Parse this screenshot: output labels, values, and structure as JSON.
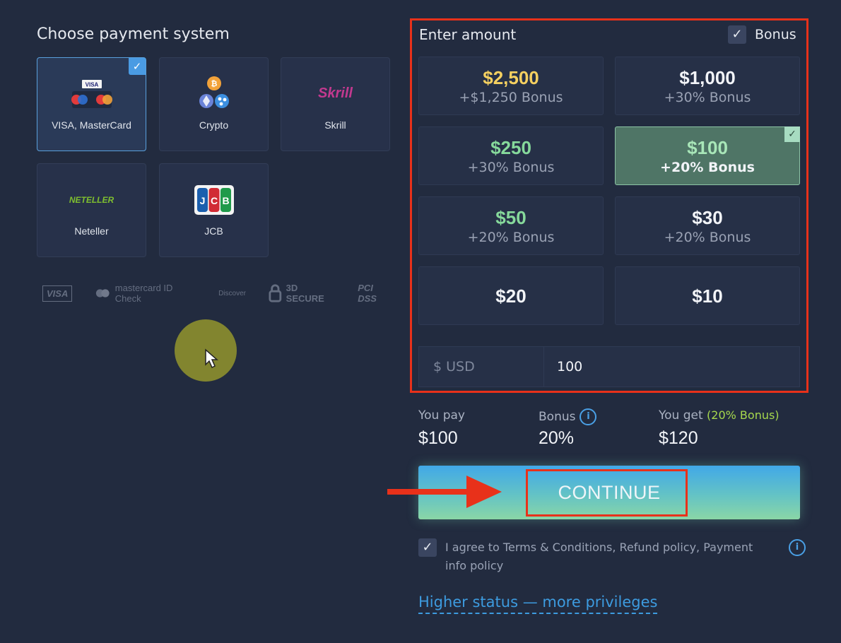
{
  "left": {
    "title": "Choose payment system",
    "methods": [
      {
        "label": "VISA, MasterCard",
        "icon": "visa-mastercard-icon",
        "selected": true,
        "logo_text": "VISA"
      },
      {
        "label": "Crypto",
        "icon": "crypto-icon",
        "selected": false,
        "logo_text": ""
      },
      {
        "label": "Skrill",
        "icon": "skrill-icon",
        "selected": false,
        "logo_text": "Skrill"
      },
      {
        "label": "Neteller",
        "icon": "neteller-icon",
        "selected": false,
        "logo_text": "NETELLER"
      },
      {
        "label": "JCB",
        "icon": "jcb-icon",
        "selected": false,
        "logo_text": "JCB"
      }
    ],
    "trust_badges": [
      {
        "text": "VISA",
        "icon": "visa-badge-icon"
      },
      {
        "text": "mastercard ID Check",
        "icon": "mastercard-idcheck-icon"
      },
      {
        "text": "Discover",
        "icon": "discover-protect-icon"
      },
      {
        "text": "3D SECURE",
        "icon": "lock-3d-secure-icon"
      },
      {
        "text": "PCI DSS",
        "icon": "pci-dss-icon"
      }
    ]
  },
  "amount": {
    "title": "Enter amount",
    "bonus_label": "Bonus",
    "bonus_checked": true,
    "tiles": [
      {
        "amount": "$2,500",
        "bonus": "+$1,250 Bonus",
        "color": "#f5d060",
        "selected": false
      },
      {
        "amount": "$1,000",
        "bonus": "+30% Bonus",
        "color": "#f2f4f8",
        "selected": false
      },
      {
        "amount": "$250",
        "bonus": "+30% Bonus",
        "color": "#86d99b",
        "selected": false
      },
      {
        "amount": "$100",
        "bonus": "+20% Bonus",
        "color": "#a8e6b8",
        "selected": true
      },
      {
        "amount": "$50",
        "bonus": "+20% Bonus",
        "color": "#86d99b",
        "selected": false
      },
      {
        "amount": "$30",
        "bonus": "+20% Bonus",
        "color": "#f2f4f8",
        "selected": false
      },
      {
        "amount": "$20",
        "bonus": "",
        "color": "#f2f4f8",
        "selected": false
      },
      {
        "amount": "$10",
        "bonus": "",
        "color": "#f2f4f8",
        "selected": false
      }
    ],
    "currency_label": "$ USD",
    "input_value": "100"
  },
  "summary": {
    "you_pay_label": "You pay",
    "you_pay_value": "$100",
    "bonus_label": "Bonus",
    "bonus_value": "20%",
    "you_get_label": "You get",
    "you_get_note": "(20% Bonus)",
    "you_get_value": "$120"
  },
  "continue_label": "CONTINUE",
  "agree": {
    "checked": true,
    "text": "I agree to Terms & Conditions, Refund policy, Payment info policy"
  },
  "higher_status": "Higher status — more privileges",
  "colors": {
    "accent_blue": "#3d9bdf",
    "highlight_red": "#e8311a",
    "selected_green": "#4f7566"
  }
}
